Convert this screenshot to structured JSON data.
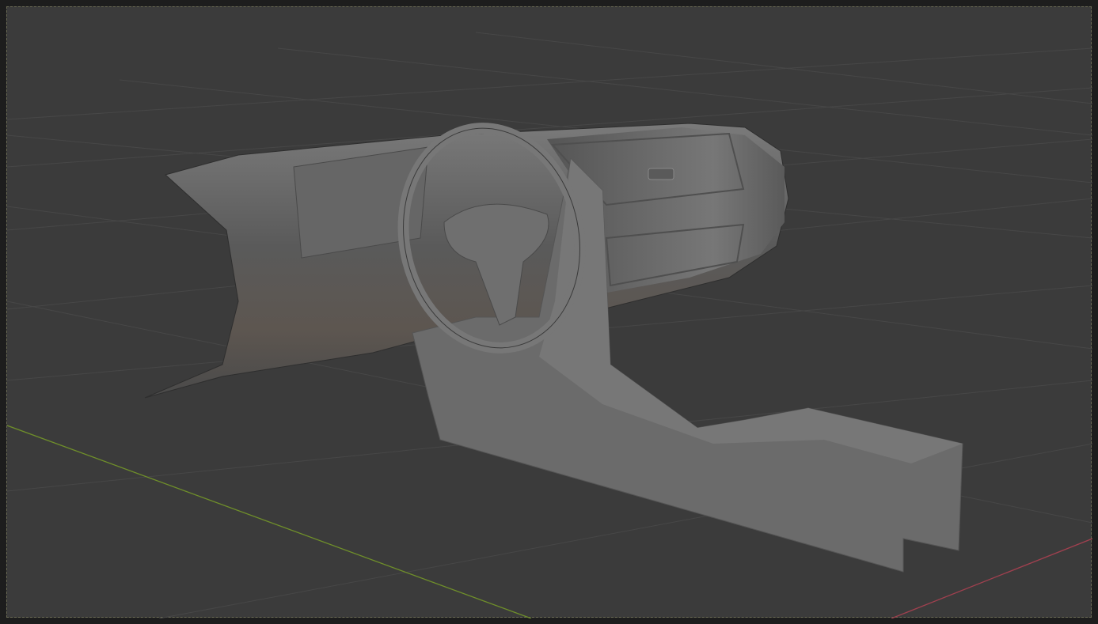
{
  "viewport": {
    "background": "#3b3b3b",
    "grid_color": "#4a4a4a",
    "x_axis_color": "#a0404f",
    "y_axis_color": "#6f8f2a",
    "model_color": "#6e6e6e"
  }
}
